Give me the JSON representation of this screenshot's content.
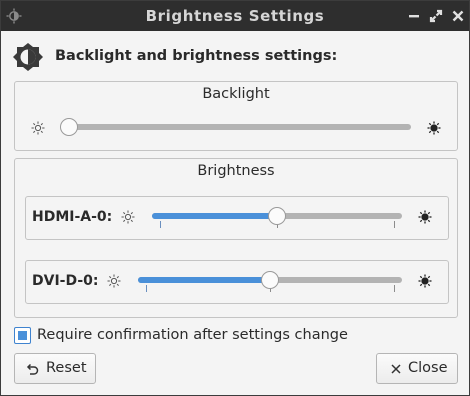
{
  "window": {
    "title": "Brightness Settings"
  },
  "header": {
    "text": "Backlight and brightness settings:"
  },
  "backlight": {
    "title": "Backlight",
    "value_fraction": 0.0
  },
  "brightness": {
    "title": "Brightness",
    "outputs": [
      {
        "label": "HDMI-A-0:",
        "value_fraction": 0.5
      },
      {
        "label": "DVI-D-0:",
        "value_fraction": 0.5
      }
    ]
  },
  "confirmation": {
    "label": "Require confirmation after settings change",
    "checked": true
  },
  "buttons": {
    "reset_label": "Reset",
    "close_label": "Close"
  },
  "icons": {
    "app": "brightness-icon",
    "header": "brightness-icon",
    "low": "sun-low-icon",
    "high": "sun-high-icon",
    "reset": "undo-icon",
    "close": "close-icon"
  },
  "colors": {
    "titlebar": "#2e2e2e",
    "accent": "#4a90d9",
    "track": "#b3b3b3"
  }
}
